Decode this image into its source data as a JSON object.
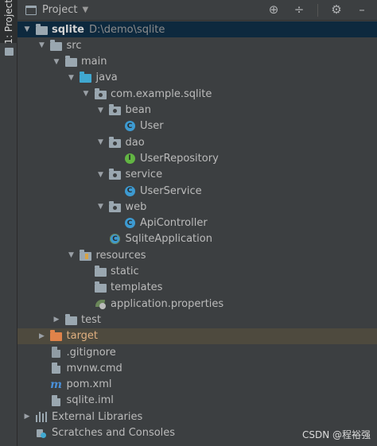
{
  "side": {
    "tab_label": "1: Project"
  },
  "header": {
    "title": "Project",
    "caret": "▼",
    "tools": {
      "locate": "⊕",
      "collapse": "÷",
      "settings": "⚙",
      "hide": "–"
    }
  },
  "tree": [
    {
      "label": "sqlite",
      "path": "D:\\demo\\sqlite",
      "arrow": "▼",
      "icon": "module",
      "depth": 0,
      "selected": true,
      "bold": true
    },
    {
      "label": "src",
      "arrow": "▼",
      "icon": "folder",
      "depth": 1
    },
    {
      "label": "main",
      "arrow": "▼",
      "icon": "folder",
      "depth": 2
    },
    {
      "label": "java",
      "arrow": "▼",
      "icon": "folder-blue",
      "depth": 3
    },
    {
      "label": "com.example.sqlite",
      "arrow": "▼",
      "icon": "package",
      "depth": 4
    },
    {
      "label": "bean",
      "arrow": "▼",
      "icon": "package",
      "depth": 5
    },
    {
      "label": "User",
      "arrow": "",
      "icon": "class",
      "depth": 6
    },
    {
      "label": "dao",
      "arrow": "▼",
      "icon": "package",
      "depth": 5
    },
    {
      "label": "UserRepository",
      "arrow": "",
      "icon": "interface",
      "depth": 6
    },
    {
      "label": "service",
      "arrow": "▼",
      "icon": "package",
      "depth": 5
    },
    {
      "label": "UserService",
      "arrow": "",
      "icon": "class",
      "depth": 6
    },
    {
      "label": "web",
      "arrow": "▼",
      "icon": "package",
      "depth": 5
    },
    {
      "label": "ApiController",
      "arrow": "",
      "icon": "class",
      "depth": 6
    },
    {
      "label": "SqliteApplication",
      "arrow": "",
      "icon": "spring-class",
      "depth": 5
    },
    {
      "label": "resources",
      "arrow": "▼",
      "icon": "resources",
      "depth": 3
    },
    {
      "label": "static",
      "arrow": "",
      "icon": "folder",
      "depth": 4
    },
    {
      "label": "templates",
      "arrow": "",
      "icon": "folder",
      "depth": 4
    },
    {
      "label": "application.properties",
      "arrow": "",
      "icon": "properties",
      "depth": 4
    },
    {
      "label": "test",
      "arrow": "▶",
      "icon": "folder",
      "depth": 2
    },
    {
      "label": "target",
      "arrow": "▶",
      "icon": "folder-orange",
      "depth": 1,
      "excluded": true
    },
    {
      "label": ".gitignore",
      "arrow": "",
      "icon": "file-git",
      "depth": 1
    },
    {
      "label": "mvnw.cmd",
      "arrow": "",
      "icon": "file",
      "depth": 1
    },
    {
      "label": "pom.xml",
      "arrow": "",
      "icon": "maven",
      "depth": 1
    },
    {
      "label": "sqlite.iml",
      "arrow": "",
      "icon": "file",
      "depth": 1
    },
    {
      "label": "External Libraries",
      "arrow": "▶",
      "icon": "libraries",
      "depth": 0
    },
    {
      "label": "Scratches and Consoles",
      "arrow": "",
      "icon": "scratches",
      "depth": 0
    }
  ],
  "watermark": "CSDN @程裕强"
}
